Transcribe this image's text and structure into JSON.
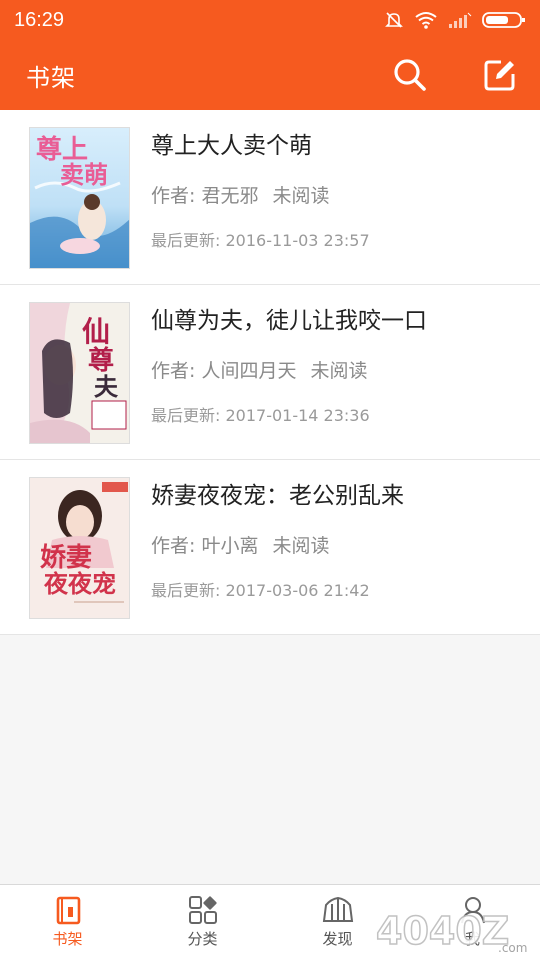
{
  "status_bar": {
    "time": "16:29"
  },
  "app_bar": {
    "title": "书架",
    "colors": {
      "accent": "#f65a1f"
    }
  },
  "books": [
    {
      "title": "尊上大人卖个萌",
      "author": "作者: 君无邪",
      "read_status": "未阅读",
      "last_updated": "最后更新: 2016-11-03 23:57"
    },
    {
      "title": "仙尊为夫，徒儿让我咬一口",
      "author": "作者: 人间四月天",
      "read_status": "未阅读",
      "last_updated": "最后更新: 2017-01-14 23:36"
    },
    {
      "title": "娇妻夜夜宠：老公别乱来",
      "author": "作者: 叶小离",
      "read_status": "未阅读",
      "last_updated": "最后更新: 2017-03-06 21:42"
    }
  ],
  "bottom_nav": {
    "items": [
      {
        "label": "书架",
        "icon": "bookshelf-icon",
        "active": true
      },
      {
        "label": "分类",
        "icon": "category-icon",
        "active": false
      },
      {
        "label": "发现",
        "icon": "discover-icon",
        "active": false
      },
      {
        "label": "我",
        "icon": "profile-icon",
        "active": false
      }
    ]
  }
}
